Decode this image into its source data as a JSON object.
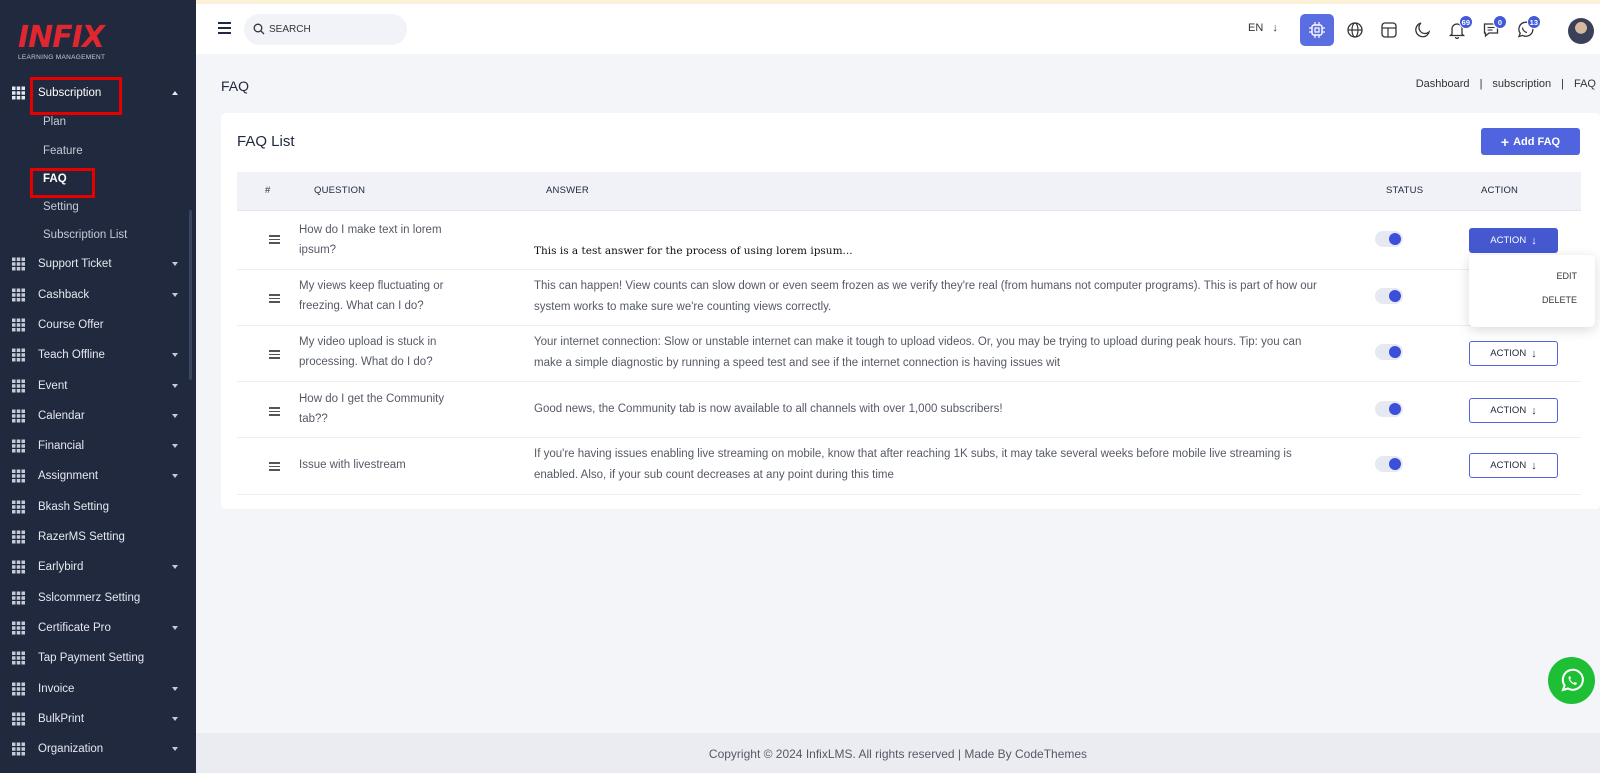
{
  "brand": {
    "logo": "INFIX",
    "tagline": "LEARNING MANAGEMENT"
  },
  "sidebar": {
    "items": [
      {
        "label": "Subscription",
        "expanded": true
      },
      {
        "label": "Support Ticket"
      },
      {
        "label": "Cashback"
      },
      {
        "label": "Course Offer"
      },
      {
        "label": "Teach Offline"
      },
      {
        "label": "Event"
      },
      {
        "label": "Calendar"
      },
      {
        "label": "Financial"
      },
      {
        "label": "Assignment"
      },
      {
        "label": "Bkash Setting"
      },
      {
        "label": "RazerMS Setting"
      },
      {
        "label": "Earlybird"
      },
      {
        "label": "Sslcommerz Setting"
      },
      {
        "label": "Certificate Pro"
      },
      {
        "label": "Tap Payment Setting"
      },
      {
        "label": "Invoice"
      },
      {
        "label": "BulkPrint"
      },
      {
        "label": "Organization"
      }
    ],
    "subscription_children": [
      "Plan",
      "Feature",
      "FAQ",
      "Setting",
      "Subscription List"
    ],
    "active_child": "FAQ"
  },
  "header": {
    "search_placeholder": "SEARCH",
    "language": "EN",
    "notifications_count": "69",
    "messages_count": "0",
    "chat_count": "13"
  },
  "page": {
    "title": "FAQ",
    "breadcrumb": [
      "Dashboard",
      "subscription",
      "FAQ"
    ]
  },
  "card": {
    "title": "FAQ List",
    "add_button": "Add FAQ"
  },
  "table": {
    "headers": {
      "index": "#",
      "question": "QUESTION",
      "answer": "ANSWER",
      "status": "STATUS",
      "action": "ACTION"
    },
    "action_label": "ACTION",
    "rows": [
      {
        "question": "How do I make text in lorem ipsum?",
        "answer": "This is a test answer for the process of using lorem ipsum...",
        "status": true
      },
      {
        "question": "My views keep fluctuating or freezing. What can I do?",
        "answer": "This can happen! View counts can slow down or even seem frozen as we verify they're real (from humans not computer programs). This is part of how our system works to make sure we're counting views correctly.",
        "status": true
      },
      {
        "question": "My video upload is stuck in processing. What do I do?",
        "answer": "Your internet connection: Slow or unstable internet can make it tough to upload videos. Or, you may be trying to upload during peak hours. Tip: you can make a simple diagnostic by running a speed test and see if the internet connection is having issues wit",
        "status": true
      },
      {
        "question": "How do I get the Community tab??",
        "answer": "Good news, the Community tab is now available to all channels with over 1,000 subscribers!",
        "status": true
      },
      {
        "question": "Issue with livestream",
        "answer": "If you're having issues enabling live streaming on mobile, know that after reaching 1K subs, it may take several weeks before mobile live streaming is enabled. Also, if your sub count decreases at any point during this time",
        "status": true
      }
    ],
    "dropdown": {
      "edit": "EDIT",
      "delete": "DELETE"
    }
  },
  "footer": {
    "text": "Copyright © 2024 InfixLMS. All rights reserved | Made By CodeThemes"
  },
  "colors": {
    "sidebar_bg": "#20293e",
    "primary": "#5064df",
    "highlight": "#e60000",
    "whatsapp": "#1fbf35"
  }
}
